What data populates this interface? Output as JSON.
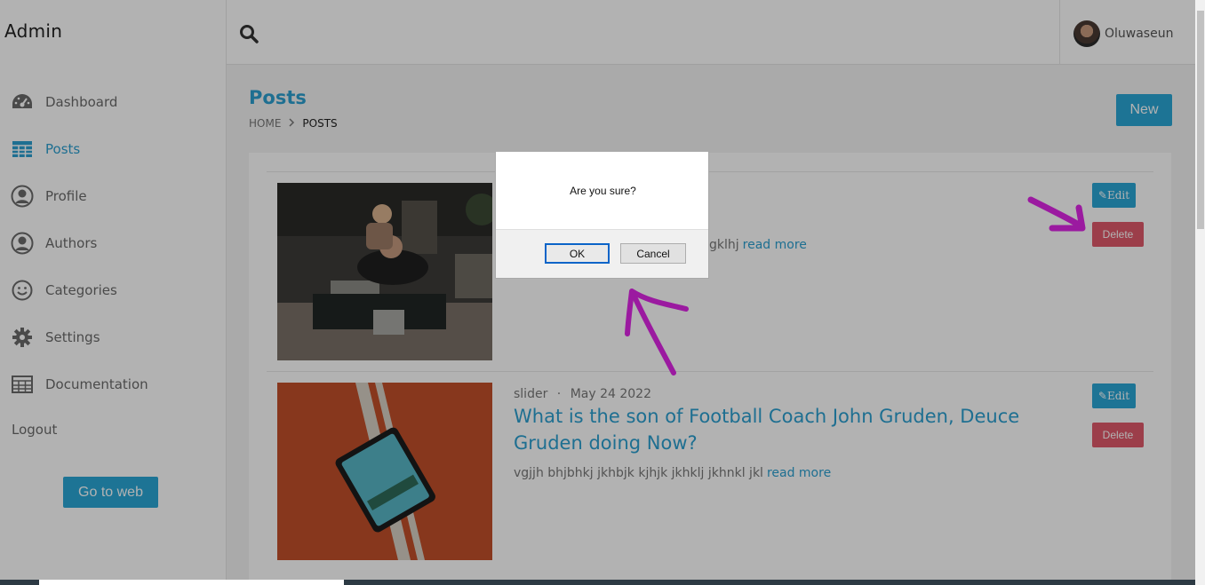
{
  "sidebar": {
    "brand": "Admin",
    "items": [
      {
        "label": "Dashboard",
        "icon": "dashboard-icon"
      },
      {
        "label": "Posts",
        "icon": "table-icon",
        "active": true
      },
      {
        "label": "Profile",
        "icon": "user-circle-icon"
      },
      {
        "label": "Authors",
        "icon": "user-circle-icon"
      },
      {
        "label": "Categories",
        "icon": "smile-icon"
      },
      {
        "label": "Settings",
        "icon": "gear-icon"
      },
      {
        "label": "Documentation",
        "icon": "table-icon"
      }
    ],
    "logout_label": "Logout",
    "goto_web_label": "Go to web"
  },
  "topbar": {
    "search_icon": "search-icon",
    "username": "Oluwaseun"
  },
  "page": {
    "title": "Posts",
    "breadcrumb": {
      "home": "HOME",
      "current": "POSTS"
    },
    "new_label": "New"
  },
  "posts": [
    {
      "category": "",
      "date": "",
      "title": "",
      "excerpt_visible_end": "gklhj",
      "read_more": "read more",
      "edit_label": "Edit",
      "delete_label": "Delete"
    },
    {
      "category": "slider",
      "separator": "·",
      "date": "May 24 2022",
      "title": "What is the son of Football Coach John Gruden, Deuce Gruden doing Now?",
      "excerpt": "vgjjh bhjbhkj jkhbjk kjhjk jkhklj jkhnkl jkl",
      "read_more": "read more",
      "edit_label": "Edit",
      "delete_label": "Delete"
    }
  ],
  "dialog": {
    "message": "Are you sure?",
    "ok_label": "OK",
    "cancel_label": "Cancel"
  },
  "colors": {
    "accent": "#2aa7d6",
    "danger": "#e05a6a",
    "annotation": "#9b1aa0"
  }
}
